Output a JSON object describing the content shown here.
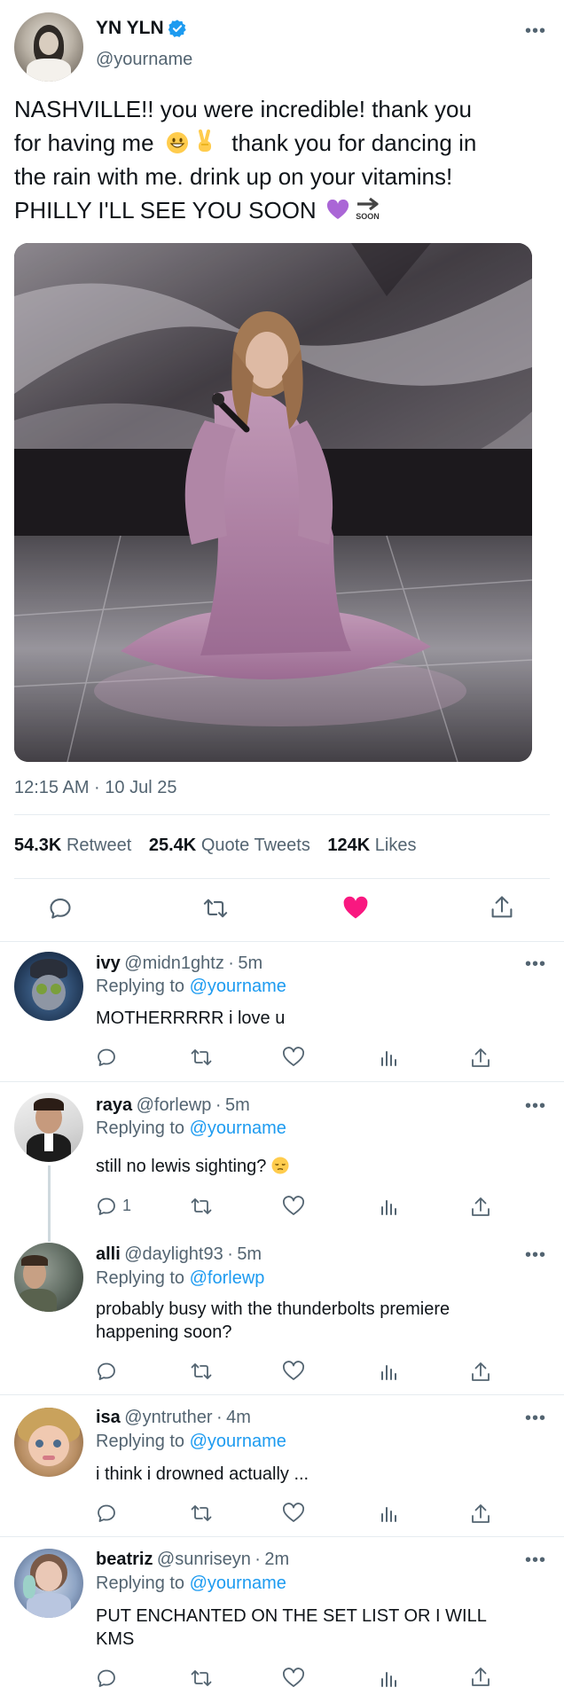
{
  "author": {
    "name": "YN YLN",
    "handle": "@yourname"
  },
  "tweet": {
    "lines": [
      "NASHVILLE!! you were incredible! thank you",
      "for having me",
      "thank you for dancing in",
      "the rain with me. drink up on your vitamins!",
      "PHILLY I'LL SEE YOU SOON"
    ],
    "emojis": [
      "grinning-face",
      "victory-hand",
      "purple-heart",
      "soon-arrow"
    ],
    "soon_badge": "SOON",
    "timestamp": "12:15 AM · 10 Jul 25"
  },
  "stats": {
    "retweets_count": "54.3K",
    "retweets_label": "Retweet",
    "quotes_count": "25.4K",
    "quotes_label": "Quote Tweets",
    "likes_count": "124K",
    "likes_label": "Likes"
  },
  "action_icons": [
    "reply-icon",
    "retweet-icon",
    "heart-filled-icon",
    "share-icon"
  ],
  "replying_label": "Replying to",
  "colors": {
    "accent": "#1d9bf0",
    "like": "#f91880",
    "muted": "#536471"
  },
  "replies": [
    {
      "name": "ivy",
      "handle": "@midn1ghtz",
      "time": "5m",
      "to": "@yourname",
      "text": [
        "MOTHERRRRR i love u"
      ],
      "reply_count": ""
    },
    {
      "name": "raya",
      "handle": "@forlewp",
      "time": "5m",
      "to": "@yourname",
      "text": [
        "still no lewis sighting?"
      ],
      "reply_count": "1"
    },
    {
      "name": "alli",
      "handle": "@daylight93",
      "time": "5m",
      "to": "@forlewp",
      "text": [
        "probably busy with the thunderbolts premiere",
        "happening soon?"
      ],
      "reply_count": ""
    },
    {
      "name": "isa",
      "handle": "@yntruther",
      "time": "4m",
      "to": "@yourname",
      "text": [
        "i think i drowned actually ..."
      ],
      "reply_count": ""
    },
    {
      "name": "beatriz",
      "handle": "@sunriseyn",
      "time": "2m",
      "to": "@yourname",
      "text": [
        "PUT ENCHANTED ON THE SET LIST OR I WILL",
        "KMS"
      ],
      "reply_count": ""
    }
  ]
}
